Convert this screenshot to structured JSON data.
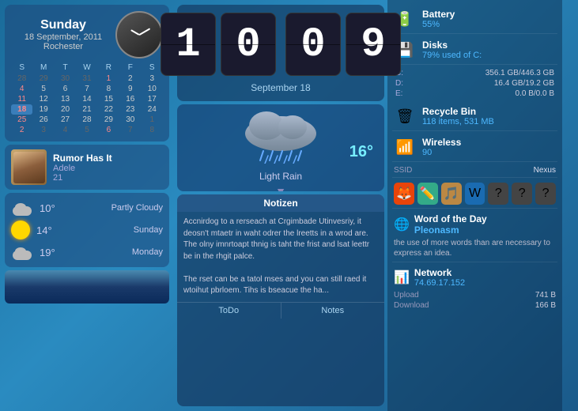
{
  "left": {
    "day_name": "Sunday",
    "date_line": "18 September, 2011",
    "location": "Rochester",
    "calendar": {
      "headers": [
        "S",
        "M",
        "T",
        "W",
        "R",
        "F",
        "S"
      ],
      "weeks": [
        [
          {
            "d": "28",
            "cls": "other-month"
          },
          {
            "d": "29",
            "cls": "other-month"
          },
          {
            "d": "30",
            "cls": "other-month"
          },
          {
            "d": "31",
            "cls": "other-month"
          },
          {
            "d": "1",
            "cls": "weekend"
          },
          {
            "d": "2",
            "cls": ""
          },
          {
            "d": "3",
            "cls": ""
          }
        ],
        [
          {
            "d": "4",
            "cls": "weekend"
          },
          {
            "d": "5",
            "cls": ""
          },
          {
            "d": "6",
            "cls": ""
          },
          {
            "d": "7",
            "cls": ""
          },
          {
            "d": "8",
            "cls": ""
          },
          {
            "d": "9",
            "cls": ""
          },
          {
            "d": "10",
            "cls": ""
          }
        ],
        [
          {
            "d": "11",
            "cls": "weekend"
          },
          {
            "d": "12",
            "cls": ""
          },
          {
            "d": "13",
            "cls": ""
          },
          {
            "d": "14",
            "cls": ""
          },
          {
            "d": "15",
            "cls": ""
          },
          {
            "d": "16",
            "cls": ""
          },
          {
            "d": "17",
            "cls": ""
          }
        ],
        [
          {
            "d": "18",
            "cls": "today weekend"
          },
          {
            "d": "19",
            "cls": ""
          },
          {
            "d": "20",
            "cls": ""
          },
          {
            "d": "21",
            "cls": ""
          },
          {
            "d": "22",
            "cls": ""
          },
          {
            "d": "23",
            "cls": ""
          },
          {
            "d": "24",
            "cls": ""
          }
        ],
        [
          {
            "d": "25",
            "cls": "weekend"
          },
          {
            "d": "26",
            "cls": ""
          },
          {
            "d": "27",
            "cls": ""
          },
          {
            "d": "28",
            "cls": ""
          },
          {
            "d": "29",
            "cls": ""
          },
          {
            "d": "30",
            "cls": ""
          },
          {
            "d": "1",
            "cls": "other-month"
          }
        ],
        [
          {
            "d": "2",
            "cls": "other-month weekend"
          },
          {
            "d": "3",
            "cls": "other-month"
          },
          {
            "d": "4",
            "cls": "other-month"
          },
          {
            "d": "5",
            "cls": "other-month"
          },
          {
            "d": "6",
            "cls": "other-month weekend"
          },
          {
            "d": "7",
            "cls": "other-month"
          },
          {
            "d": "8",
            "cls": "other-month"
          }
        ]
      ]
    },
    "music": {
      "title": "Rumor Has It",
      "artist": "Adele",
      "track": "21"
    },
    "weather": [
      {
        "temp": "10°",
        "desc": "Partly Cloudy",
        "type": "cloud"
      },
      {
        "temp": "14°",
        "desc": "Sunday",
        "type": "sun"
      },
      {
        "temp": "19°",
        "desc": "Monday",
        "type": "cloud"
      }
    ]
  },
  "middle": {
    "clock": {
      "hour1": "1",
      "hour2": "0",
      "min1": "0",
      "min2": "9",
      "date": "September  18"
    },
    "weather_big": {
      "temp": "16°",
      "label": "Light Rain",
      "arrow": "▼"
    },
    "notizen": {
      "header": "Notizen",
      "text1": "Accnirdog to a rerseach at Crgimbade Utinvesriy, it deosn't mtaetr in waht odrer the lreetts in a wrod are. The olny imnrtoapt thnig is taht the frist and lsat leettr be in the rhgit palce.",
      "text2": "The rset can be a tatol mses and you can still raed it wtoihut pbrloem. Tihs is bseacue the ha...",
      "btn1": "ToDo",
      "btn2": "Notes"
    }
  },
  "right": {
    "battery": {
      "label": "Battery",
      "value": "55%",
      "pct": 55
    },
    "disks": {
      "label": "Disks",
      "value": "79% used of C:",
      "rows": [
        {
          "letter": "C:",
          "size": "356.1 GB/446.3 GB"
        },
        {
          "letter": "D:",
          "size": "16.4 GB/19.2 GB"
        },
        {
          "letter": "E:",
          "size": "0.0 B/0.0 B"
        }
      ]
    },
    "recycle": {
      "label": "Recycle Bin",
      "value": "118  items, 531 MB"
    },
    "wireless": {
      "label": "Wireless",
      "value": "90",
      "ssid_label": "SSID",
      "ssid_value": "Nexus"
    },
    "app_icons": [
      "🦊",
      "📝",
      "🎵",
      "W",
      "❓",
      "❓",
      "❓"
    ],
    "wotd": {
      "label": "Word of the Day",
      "word": "Pleonasm",
      "definition": "the use of more words than are necessary to express an idea."
    },
    "network": {
      "label": "Network",
      "ip": "74.69.17.152",
      "upload_label": "Upload",
      "upload_val": "741 B",
      "download_label": "Download",
      "download_val": "166 B"
    }
  }
}
